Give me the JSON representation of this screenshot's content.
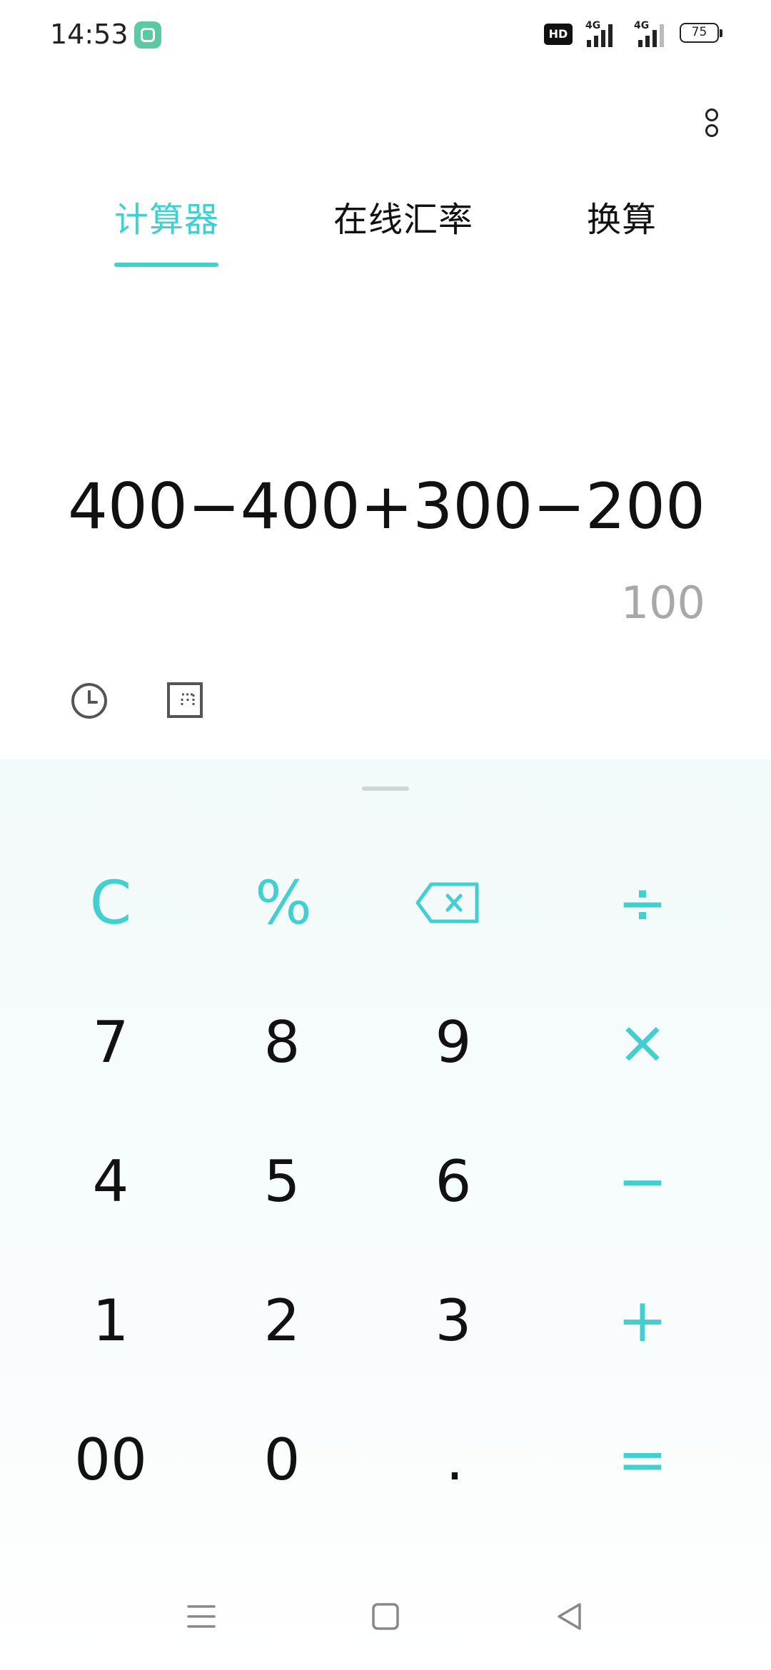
{
  "status": {
    "time": "14:53",
    "hd_label": "HD",
    "signal1_label": "4G",
    "signal2_label": "4G",
    "battery": "75"
  },
  "tabs": [
    {
      "label": "计算器",
      "active": true
    },
    {
      "label": "在线汇率",
      "active": false
    },
    {
      "label": "换算",
      "active": false
    }
  ],
  "display": {
    "expression": "400−400+300−200",
    "result": "100"
  },
  "keys": {
    "clear": "C",
    "percent": "%",
    "divide": "÷",
    "multiply": "×",
    "minus": "−",
    "plus": "+",
    "equals": "=",
    "seven": "7",
    "eight": "8",
    "nine": "9",
    "four": "4",
    "five": "5",
    "six": "6",
    "one": "1",
    "two": "2",
    "three": "3",
    "double_zero": "00",
    "zero": "0",
    "dot": "."
  },
  "colors": {
    "accent": "#43cfd0",
    "keypad_background": "#f3fafa",
    "result_text": "#a8a8a8"
  },
  "icons": {
    "app_badge": "app-badge-icon",
    "history": "clock-icon",
    "mode": "scientific-mode-icon",
    "backspace": "backspace-icon",
    "more": "more-vertical-icon",
    "nav_recent": "menu-lines-icon",
    "nav_home": "home-square-icon",
    "nav_back": "back-triangle-icon"
  }
}
